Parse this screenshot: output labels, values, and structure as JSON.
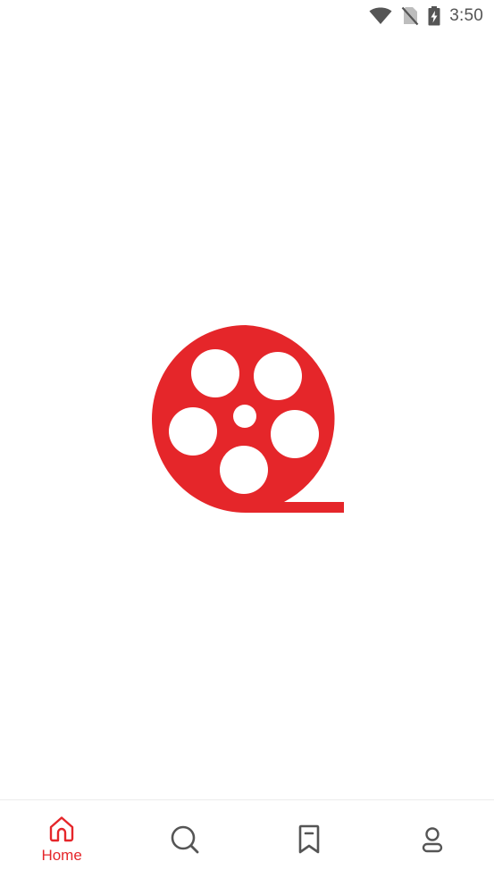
{
  "status_bar": {
    "time": "3:50",
    "icons": [
      "wifi-icon",
      "no-sim-icon",
      "battery-charging-icon"
    ]
  },
  "splash": {
    "logo": "film-reel-logo",
    "logo_color": "#e5262a"
  },
  "bottom_nav": {
    "active_color": "#e5262a",
    "inactive_color": "#555555",
    "items": [
      {
        "icon": "home-icon",
        "label": "Home",
        "active": true
      },
      {
        "icon": "search-icon",
        "label": "",
        "active": false
      },
      {
        "icon": "bookmark-icon",
        "label": "",
        "active": false
      },
      {
        "icon": "profile-icon",
        "label": "",
        "active": false
      }
    ]
  }
}
